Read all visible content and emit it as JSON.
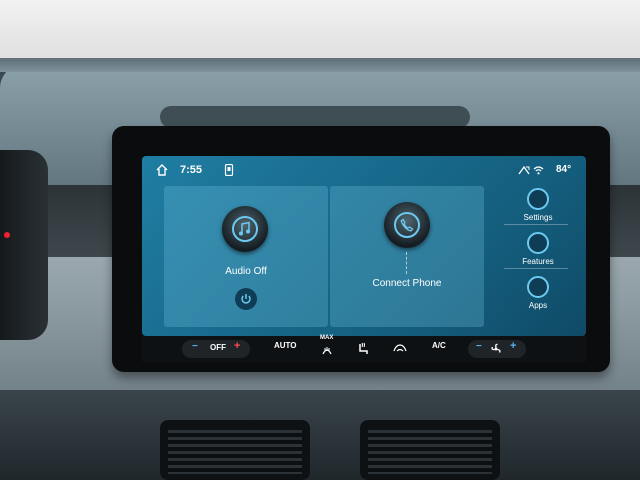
{
  "status_bar": {
    "time": "7:55",
    "temperature": "84°",
    "icons": [
      "home-icon",
      "phone-icon",
      "signal-icon",
      "wifi-icon"
    ]
  },
  "cards": {
    "audio": {
      "label": "Audio Off",
      "icon": "music-note-icon"
    },
    "phone": {
      "label": "Connect Phone",
      "icon": "phone-icon"
    }
  },
  "side_menu": [
    {
      "label": "Settings",
      "icon": "settings-icon"
    },
    {
      "label": "Features",
      "icon": "car-icon"
    },
    {
      "label": "Apps",
      "icon": "apps-icon"
    }
  ],
  "climate_bar": {
    "fan_minus": "−",
    "fan_label": "OFF",
    "fan_plus": "+",
    "auto": "AUTO",
    "max": "MAX",
    "ac": "A/C",
    "temp_minus": "−",
    "temp_plus": "+"
  },
  "colors": {
    "screen_bg": "#1a6f93",
    "accent": "#6cc9f0",
    "plus": "#ff4a4a",
    "minus": "#5ab2e8"
  }
}
